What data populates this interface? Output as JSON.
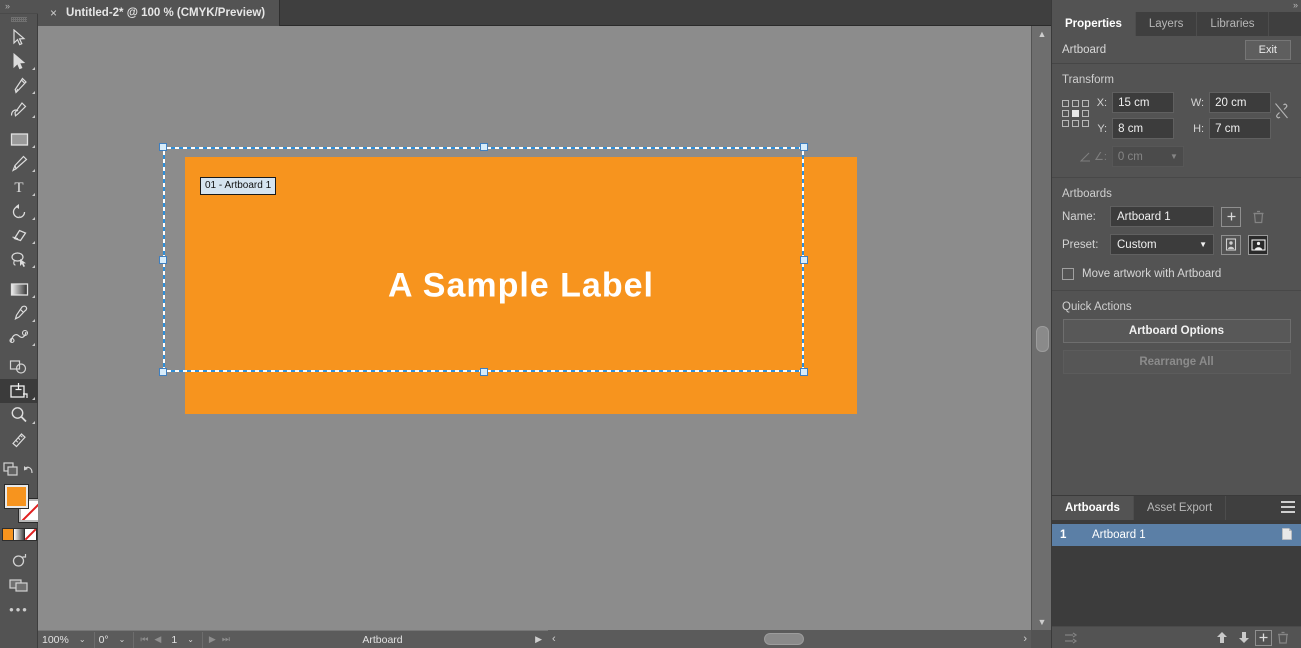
{
  "window": {
    "document_tab": {
      "title": "Untitled-2* @ 100 % (CMYK/Preview)",
      "close_label": "×"
    },
    "collapse_icon": "»"
  },
  "toolbar": {
    "tools": [
      {
        "name": "selection-tool",
        "label": "Selection"
      },
      {
        "name": "direct-selection-tool",
        "label": "Direct Selection"
      },
      {
        "name": "pen-tool",
        "label": "Pen"
      },
      {
        "name": "curvature-tool",
        "label": "Curvature"
      },
      {
        "name": "rectangle-tool",
        "label": "Rectangle"
      },
      {
        "name": "paintbrush-tool",
        "label": "Paintbrush"
      },
      {
        "name": "type-tool",
        "label": "Type"
      },
      {
        "name": "rotate-tool",
        "label": "Rotate"
      },
      {
        "name": "eraser-tool",
        "label": "Eraser"
      },
      {
        "name": "lasso-tool",
        "label": "Lasso"
      },
      {
        "name": "gradient-tool",
        "label": "Gradient"
      },
      {
        "name": "eyedropper-tool",
        "label": "Eyedropper"
      },
      {
        "name": "blend-tool",
        "label": "Blend"
      },
      {
        "name": "shape-builder-tool",
        "label": "Shape Builder"
      },
      {
        "name": "artboard-tool",
        "label": "Artboard",
        "selected": true
      },
      {
        "name": "zoom-tool",
        "label": "Zoom"
      },
      {
        "name": "measure-tool",
        "label": "Measure"
      }
    ],
    "fill_color": "#f7941e",
    "stroke_color": "#ffffff",
    "more_tools_label": "•••"
  },
  "canvas": {
    "artboard_name_tag": "01 - Artboard 1",
    "artwork_text": "A Sample Label",
    "artboard_fill": "#f7941e"
  },
  "statusbar": {
    "zoom_level": "100%",
    "rotation": "0°",
    "artboard_number": "1",
    "mode_label": "Artboard",
    "caret": "⌄",
    "nav_first": "⏮",
    "nav_prev": "◀",
    "nav_next": "▶",
    "nav_last": "⏭",
    "play": "▶",
    "left_arrow": "‹",
    "right_arrow": "›"
  },
  "properties_panel": {
    "tabs": [
      {
        "label": "Properties",
        "active": true
      },
      {
        "label": "Layers",
        "active": false
      },
      {
        "label": "Libraries",
        "active": false
      }
    ],
    "header": {
      "title": "Artboard",
      "exit_label": "Exit"
    },
    "transform": {
      "title": "Transform",
      "x_label": "X:",
      "x_value": "15 cm",
      "y_label": "Y:",
      "y_value": "8 cm",
      "w_label": "W:",
      "w_value": "20 cm",
      "h_label": "H:",
      "h_value": "7 cm",
      "angle_label": "∠:",
      "angle_value": "0 cm",
      "link_icon": "chain-broken-icon"
    },
    "artboards": {
      "title": "Artboards",
      "name_label": "Name:",
      "name_value": "Artboard 1",
      "preset_label": "Preset:",
      "preset_value": "Custom",
      "new_artboard_icon": "plus-square-icon",
      "delete_artboard_icon": "trash-icon",
      "portrait_icon": "portrait-orientation-icon",
      "landscape_icon": "landscape-orientation-icon",
      "move_artwork_label": "Move artwork with Artboard",
      "move_artwork_checked": false
    },
    "quick_actions": {
      "title": "Quick Actions",
      "artboard_options_label": "Artboard Options",
      "rearrange_all_label": "Rearrange All",
      "rearrange_all_disabled": true
    }
  },
  "artboards_panel": {
    "tabs": [
      {
        "label": "Artboards",
        "active": true
      },
      {
        "label": "Asset Export",
        "active": false
      }
    ],
    "menu_icon": "hamburger-menu-icon",
    "items": [
      {
        "number": "1",
        "name": "Artboard 1",
        "selected": true
      }
    ],
    "footer": {
      "rearrange_icon": "rearrange-artboards-icon",
      "move_up_icon": "arrow-up-icon",
      "move_down_icon": "arrow-down-icon",
      "new_icon": "new-artboard-icon",
      "delete_icon": "trash-icon"
    }
  }
}
